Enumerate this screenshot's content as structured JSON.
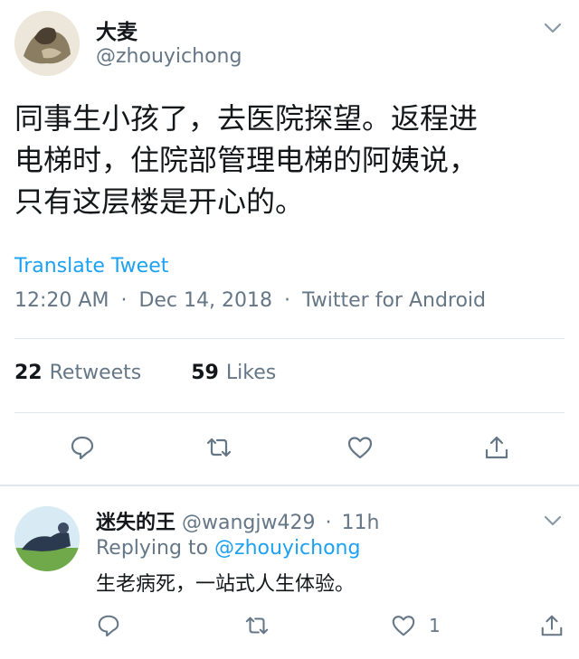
{
  "tweet": {
    "display_name": "大麦",
    "handle": "@zhouyichong",
    "text": "同事生小孩了，去医院探望。返程进\n电梯时，住院部管理电梯的阿姨说，\n只有这层楼是开心的。",
    "translate_label": "Translate Tweet",
    "time": "12:20 AM",
    "date": "Dec 14, 2018",
    "source": "Twitter for Android",
    "separator": "·",
    "retweet_count": "22",
    "retweets_label": "Retweets",
    "like_count": "59",
    "likes_label": "Likes"
  },
  "reply": {
    "display_name": "迷失的王",
    "handle": "@wangjw429",
    "separator": "·",
    "age": "11h",
    "replying_prefix": "Replying to",
    "replying_to": "@zhouyichong",
    "text": "生老病死，一站式人生体验。",
    "like_count": "1"
  },
  "colors": {
    "accent": "#1da1f2",
    "secondary_text": "#657786",
    "primary_text": "#14171a",
    "divider": "#e1e8ed"
  },
  "icons": [
    "chevron-down-icon",
    "reply-icon",
    "retweet-icon",
    "like-icon",
    "share-icon"
  ]
}
